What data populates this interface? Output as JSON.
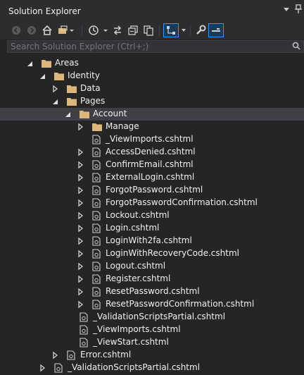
{
  "panel": {
    "title": "Solution Explorer"
  },
  "search": {
    "placeholder": "Search Solution Explorer (Ctrl+;)"
  },
  "tree": {
    "items": [
      {
        "label": "Areas",
        "type": "folder",
        "expand": "expanded",
        "level": 0
      },
      {
        "label": "Identity",
        "type": "folder",
        "expand": "expanded",
        "level": 1
      },
      {
        "label": "Data",
        "type": "folder",
        "expand": "collapsed",
        "level": 2
      },
      {
        "label": "Pages",
        "type": "folder",
        "expand": "expanded",
        "level": 2
      },
      {
        "label": "Account",
        "type": "folder",
        "expand": "expanded",
        "level": 3,
        "selected": true
      },
      {
        "label": "Manage",
        "type": "folder",
        "expand": "collapsed",
        "level": 4
      },
      {
        "label": "_ViewImports.cshtml",
        "type": "file",
        "expand": "none",
        "level": 4
      },
      {
        "label": "AccessDenied.cshtml",
        "type": "file",
        "expand": "collapsed",
        "level": 4
      },
      {
        "label": "ConfirmEmail.cshtml",
        "type": "file",
        "expand": "collapsed",
        "level": 4
      },
      {
        "label": "ExternalLogin.cshtml",
        "type": "file",
        "expand": "collapsed",
        "level": 4
      },
      {
        "label": "ForgotPassword.cshtml",
        "type": "file",
        "expand": "collapsed",
        "level": 4
      },
      {
        "label": "ForgotPasswordConfirmation.cshtml",
        "type": "file",
        "expand": "collapsed",
        "level": 4
      },
      {
        "label": "Lockout.cshtml",
        "type": "file",
        "expand": "collapsed",
        "level": 4
      },
      {
        "label": "Login.cshtml",
        "type": "file",
        "expand": "collapsed",
        "level": 4
      },
      {
        "label": "LoginWith2fa.cshtml",
        "type": "file",
        "expand": "collapsed",
        "level": 4
      },
      {
        "label": "LoginWithRecoveryCode.cshtml",
        "type": "file",
        "expand": "collapsed",
        "level": 4
      },
      {
        "label": "Logout.cshtml",
        "type": "file",
        "expand": "collapsed",
        "level": 4
      },
      {
        "label": "Register.cshtml",
        "type": "file",
        "expand": "collapsed",
        "level": 4
      },
      {
        "label": "ResetPassword.cshtml",
        "type": "file",
        "expand": "collapsed",
        "level": 4
      },
      {
        "label": "ResetPasswordConfirmation.cshtml",
        "type": "file",
        "expand": "collapsed",
        "level": 4
      },
      {
        "label": "_ValidationScriptsPartial.cshtml",
        "type": "file",
        "expand": "none",
        "level": 3
      },
      {
        "label": "_ViewImports.cshtml",
        "type": "file",
        "expand": "none",
        "level": 3
      },
      {
        "label": "_ViewStart.cshtml",
        "type": "file",
        "expand": "none",
        "level": 3
      },
      {
        "label": "Error.cshtml",
        "type": "file",
        "expand": "collapsed",
        "level": 2
      },
      {
        "label": "_ValidationScriptsPartial.cshtml",
        "type": "file",
        "expand": "collapsed",
        "level": 1
      }
    ]
  },
  "colors": {
    "background": "#252526",
    "selected_row": "#3f3f46",
    "folder": "#dcb67a",
    "active_button_border": "#3399ff"
  },
  "icons": {
    "toolbar": [
      "back-arrow-icon",
      "forward-arrow-icon",
      "home-icon",
      "switch-views-icon",
      "pending-changes-filter-icon",
      "sync-with-active-document-icon",
      "collapse-all-icon",
      "show-all-files-icon",
      "properties-wrench-icon",
      "preview-selected-items-icon"
    ],
    "window": [
      "dropdown-icon",
      "pin-icon"
    ],
    "search": "search-icon"
  }
}
